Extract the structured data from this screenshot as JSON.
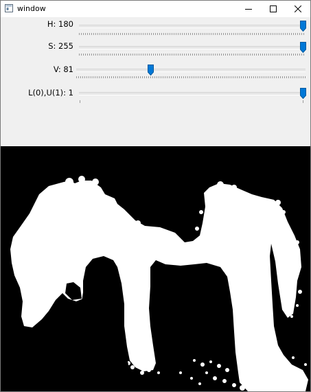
{
  "window": {
    "title": "window"
  },
  "titlebar_buttons": {
    "minimize": "minimize",
    "maximize": "maximize",
    "close": "close"
  },
  "trackbars": [
    {
      "label": "H: 180",
      "name": "H",
      "value": 180,
      "max": 180
    },
    {
      "label": "S: 255",
      "name": "S",
      "value": 255,
      "max": 255
    },
    {
      "label": "V: 81",
      "name": "V",
      "value": 81,
      "max": 255
    },
    {
      "label": "L(0),U(1): 1",
      "name": "L(0),U(1)",
      "value": 1,
      "max": 1
    }
  ],
  "colors": {
    "thumb": "#0078d7",
    "mask_foreground": "#ffffff",
    "mask_background": "#000000"
  }
}
